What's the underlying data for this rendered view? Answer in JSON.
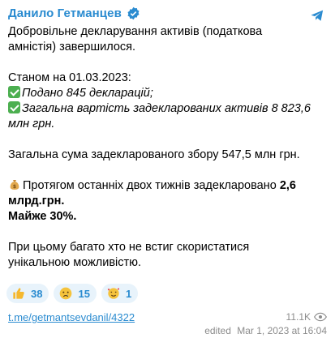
{
  "author": "Данило Гетманцев",
  "lines": {
    "l1": "Добровільне декларування активів (податкова",
    "l2": "амністія) завершилося.",
    "l3": "Станом на 01.03.2023:",
    "l4": "Подано 845 декларацій;",
    "l5a": "Загальна вартість задекларованих активів 8 823,6",
    "l5b": "млн грн.",
    "l6": "Загальна сума задекларованого збору 547,5 млн грн.",
    "l7a": "Протягом останніх двох тижнів задекларовано ",
    "l7b": "2,6",
    "l8": "млрд.грн.",
    "l9": "Майже 30%.",
    "l10": "При цьому багато хто не встиг скористатися",
    "l11": "унікальною можливістю."
  },
  "reactions": [
    {
      "icon": "thumbs-up",
      "count": "38"
    },
    {
      "icon": "crying-face",
      "count": "15"
    },
    {
      "icon": "smiling-face-with-hearts",
      "count": "1"
    }
  ],
  "link": "t.me/getmantsevdanil/4322",
  "views": "11.1K",
  "edited_label": "edited",
  "datetime": "Mar 1, 2023 at 16:04",
  "colors": {
    "accent": "#2a8bd0",
    "check": "#4caf50",
    "muted": "#8c8c8c",
    "reaction_bg": "#e8f3fb"
  }
}
